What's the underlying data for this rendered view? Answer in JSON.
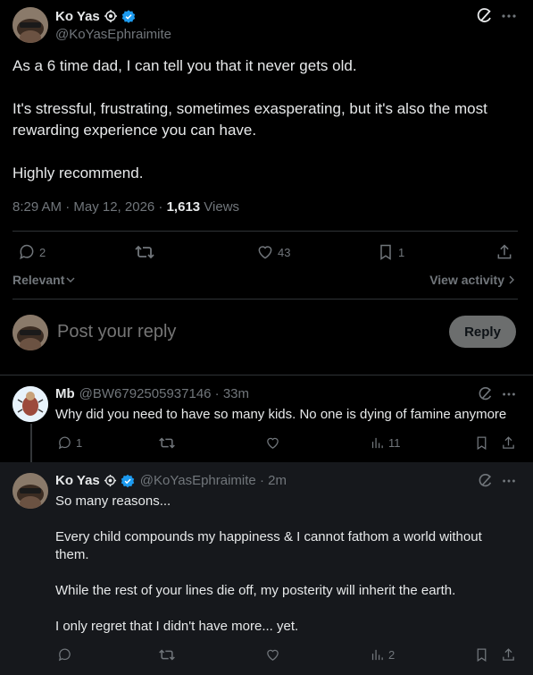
{
  "post": {
    "author_name": "Ko Yas",
    "handle": "@KoYasEphraimite",
    "lines": [
      "As a 6 time dad, I can tell you that it never gets old.",
      "It's stressful, frustrating, sometimes exasperating, but it's also the most",
      "rewarding experience you can have.",
      "Highly recommend."
    ],
    "timestamp": "8:29 AM · May 12, 2026 · ",
    "views_count": "1,613",
    "views_label": " Views",
    "replies": "2",
    "likes": "43",
    "bookmarks": "1"
  },
  "sort": {
    "label": "Relevant",
    "view_activity": "View activity"
  },
  "composer": {
    "placeholder": "Post your reply",
    "reply_button": "Reply"
  },
  "replies": [
    {
      "author_name": "Mb",
      "handle_time": "@BW6792505937146 · 33m",
      "lines": [
        "Why did you need to have so many kids. No one is dying of famine anymore"
      ],
      "replies": "1",
      "views": "11"
    },
    {
      "author_name": "Ko Yas",
      "handle_time": "@KoYasEphraimite · 2m",
      "lines": [
        "So many reasons...",
        "Every child compounds my happiness & I cannot fathom a world without",
        "them.",
        "While the rest of your lines die off, my posterity will inherit the earth.",
        "I only regret that I didn't have more... yet."
      ],
      "views": "2"
    }
  ],
  "colors": {
    "accent": "#1d9bf0",
    "muted": "#71767b",
    "background": "#000000"
  },
  "icons": [
    "grok-icon",
    "more-icon",
    "verified-badge-icon",
    "automated-icon",
    "reply-icon",
    "retweet-icon",
    "like-icon",
    "bookmark-icon",
    "share-icon",
    "analytics-icon",
    "chevron-down-icon",
    "chevron-right-icon"
  ]
}
